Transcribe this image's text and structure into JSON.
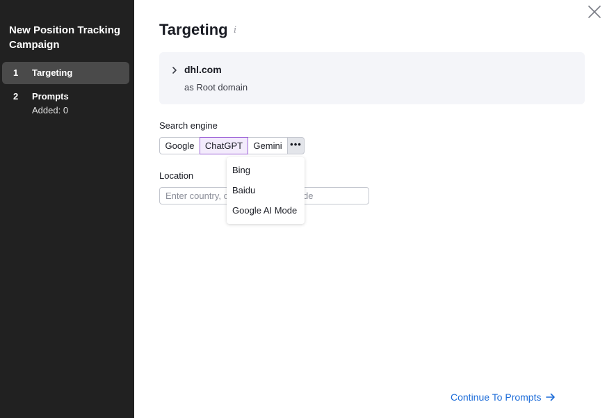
{
  "sidebar": {
    "title": "New Position Tracking Campaign",
    "steps": [
      {
        "number": "1",
        "label": "Targeting",
        "active": true
      },
      {
        "number": "2",
        "label": "Prompts",
        "sublabel": "Added: 0",
        "active": false
      }
    ]
  },
  "main": {
    "title": "Targeting",
    "info_glyph": "i",
    "domain": {
      "name": "dhl.com",
      "type": "as Root domain"
    },
    "search_engine": {
      "label": "Search engine",
      "options": [
        "Google",
        "ChatGPT",
        "Gemini"
      ],
      "selected": "ChatGPT",
      "more_label": "•••"
    },
    "more_menu": {
      "items": [
        "Bing",
        "Baidu",
        "Google AI Mode"
      ]
    },
    "location": {
      "label": "Location",
      "placeholder": "Enter country, city, street or ZIP code",
      "value": ""
    },
    "continue_label": "Continue To Prompts"
  },
  "colors": {
    "accent": "#1b6bd8",
    "selected_border": "#9a5fd6",
    "sidebar_bg": "#212121"
  }
}
